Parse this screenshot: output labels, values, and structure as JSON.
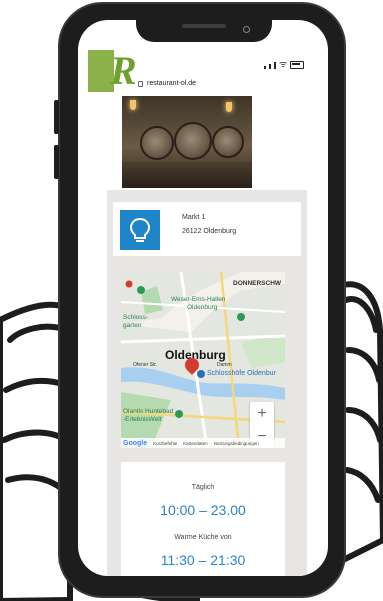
{
  "site": {
    "url": "restaurant-ol.de",
    "logo_letter": "R"
  },
  "address": {
    "street": "Markt 1",
    "city": "26122 Oldenburg"
  },
  "map": {
    "labels": {
      "area_top_right": "DONNERSCHW",
      "weser_ems": "Weser-Ems-Hallen",
      "weser_ems_city": "Oldenburg",
      "schlossgarten_1": "Schloss-",
      "schlossgarten_2": "garten",
      "city": "Oldenburg",
      "schlosshoefe": "Schlosshöfe Oldenbur",
      "huntebad_1": "Olantis Huntebad",
      "huntebad_2": "-ErlebnisWelt",
      "street_1": "Ofener Str.",
      "street_2": "Damm"
    },
    "zoom_in": "+",
    "zoom_out": "−",
    "footer": {
      "logo": "Google",
      "shortcuts": "Kurzbefehle",
      "mapdata": "Kartendaten",
      "terms": "Nutzungsbedingungen"
    }
  },
  "hours": {
    "daily_label": "Täglich",
    "daily_value": "10:00 – 23.00",
    "kitchen_label": "Warme Küche von",
    "kitchen_value": "11:30 – 21:30"
  },
  "colors": {
    "accent_blue": "#1e86c8",
    "hours_text": "#2a84c8",
    "logo_green": "#8bb24a"
  }
}
